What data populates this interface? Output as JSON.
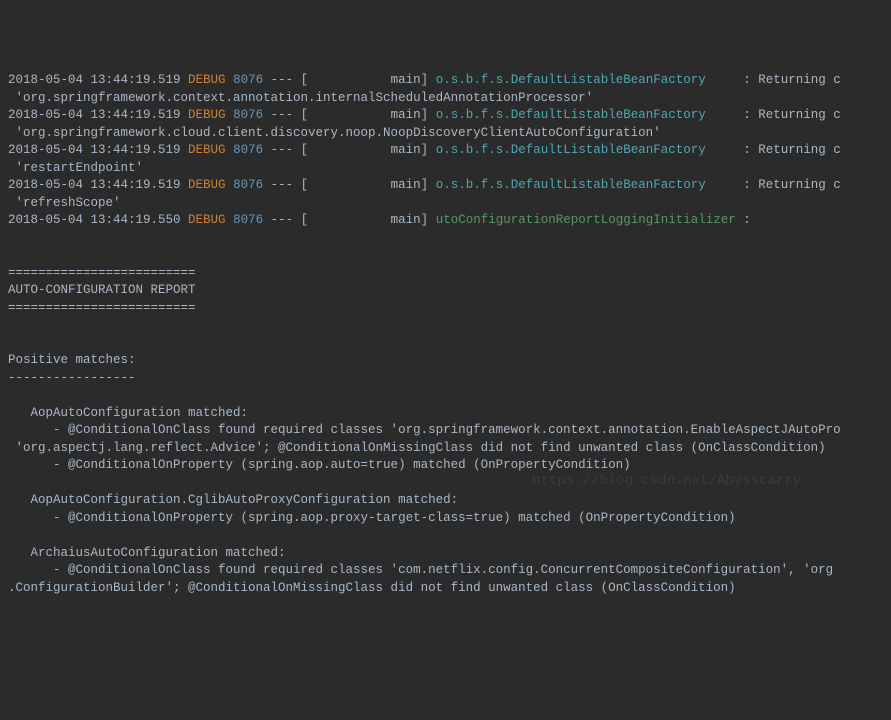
{
  "log_lines": [
    {
      "timestamp": "2018-05-04 13:44:19.519",
      "level": "DEBUG",
      "pid": "8076",
      "sep": "---",
      "thread": "[           main]",
      "logger": "o.s.b.f.s.DefaultListableBeanFactory",
      "logger_class": "logger",
      "msg": ": Returning c",
      "wrap": " 'org.springframework.context.annotation.internalScheduledAnnotationProcessor'"
    },
    {
      "timestamp": "2018-05-04 13:44:19.519",
      "level": "DEBUG",
      "pid": "8076",
      "sep": "---",
      "thread": "[           main]",
      "logger": "o.s.b.f.s.DefaultListableBeanFactory",
      "logger_class": "logger",
      "msg": ": Returning c",
      "wrap": " 'org.springframework.cloud.client.discovery.noop.NoopDiscoveryClientAutoConfiguration'"
    },
    {
      "timestamp": "2018-05-04 13:44:19.519",
      "level": "DEBUG",
      "pid": "8076",
      "sep": "---",
      "thread": "[           main]",
      "logger": "o.s.b.f.s.DefaultListableBeanFactory",
      "logger_class": "logger",
      "msg": ": Returning c",
      "wrap": " 'restartEndpoint'"
    },
    {
      "timestamp": "2018-05-04 13:44:19.519",
      "level": "DEBUG",
      "pid": "8076",
      "sep": "---",
      "thread": "[           main]",
      "logger": "o.s.b.f.s.DefaultListableBeanFactory",
      "logger_class": "logger",
      "msg": ": Returning c",
      "wrap": " 'refreshScope'"
    },
    {
      "timestamp": "2018-05-04 13:44:19.550",
      "level": "DEBUG",
      "pid": "8076",
      "sep": "---",
      "thread": "[           main]",
      "logger": "utoConfigurationReportLoggingInitializer",
      "logger_class": "logger2",
      "msg": ":",
      "wrap": ""
    }
  ],
  "report_header": {
    "divider": "=========================",
    "title": "AUTO-CONFIGURATION REPORT"
  },
  "positive": {
    "title": "Positive matches:",
    "divider": "-----------------"
  },
  "matches": [
    {
      "name": "   AopAutoConfiguration matched:",
      "reasons": [
        "      - @ConditionalOnClass found required classes 'org.springframework.context.annotation.EnableAspectJAutoPro",
        " 'org.aspectj.lang.reflect.Advice'; @ConditionalOnMissingClass did not find unwanted class (OnClassCondition)",
        "      - @ConditionalOnProperty (spring.aop.auto=true) matched (OnPropertyCondition)"
      ]
    },
    {
      "name": "   AopAutoConfiguration.CglibAutoProxyConfiguration matched:",
      "reasons": [
        "      - @ConditionalOnProperty (spring.aop.proxy-target-class=true) matched (OnPropertyCondition)"
      ]
    },
    {
      "name": "   ArchaiusAutoConfiguration matched:",
      "reasons": [
        "      - @ConditionalOnClass found required classes 'com.netflix.config.ConcurrentCompositeConfiguration', 'org",
        ".ConfigurationBuilder'; @ConditionalOnMissingClass did not find unwanted class (OnClassCondition)"
      ]
    }
  ],
  "watermark": "https://blog.csdn.net/Abysscarry"
}
